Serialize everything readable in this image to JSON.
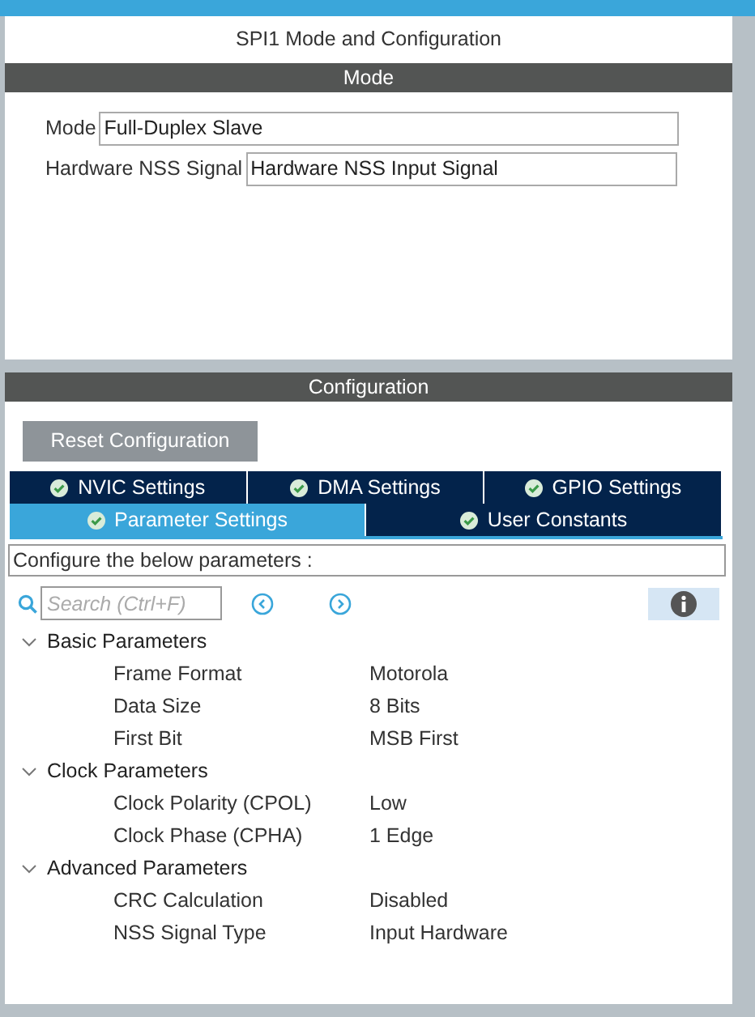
{
  "panel_title": "SPI1 Mode and Configuration",
  "mode_section": {
    "header": "Mode",
    "fields": [
      {
        "label": "Mode",
        "value": "Full-Duplex Slave"
      },
      {
        "label": "Hardware NSS Signal",
        "value": "Hardware NSS Input Signal"
      }
    ]
  },
  "configuration": {
    "header": "Configuration",
    "reset_button": "Reset Configuration",
    "tab_rows": [
      [
        {
          "label": "NVIC Settings",
          "selected": false
        },
        {
          "label": "DMA Settings",
          "selected": false
        },
        {
          "label": "GPIO Settings",
          "selected": false
        }
      ],
      [
        {
          "label": "Parameter Settings",
          "selected": true
        },
        {
          "label": "User Constants",
          "selected": false
        }
      ]
    ],
    "description": "Configure the below parameters :",
    "search": {
      "placeholder": "Search (Ctrl+F)"
    },
    "groups": [
      {
        "label": "Basic Parameters",
        "expanded": true,
        "children": [
          {
            "name": "Frame Format",
            "value": "Motorola"
          },
          {
            "name": "Data Size",
            "value": "8 Bits"
          },
          {
            "name": "First Bit",
            "value": "MSB First"
          }
        ]
      },
      {
        "label": "Clock Parameters",
        "expanded": true,
        "children": [
          {
            "name": "Clock Polarity (CPOL)",
            "value": "Low"
          },
          {
            "name": "Clock Phase (CPHA)",
            "value": "1 Edge"
          }
        ]
      },
      {
        "label": "Advanced Parameters",
        "expanded": true,
        "children": [
          {
            "name": "CRC Calculation",
            "value": "Disabled"
          },
          {
            "name": "NSS Signal Type",
            "value": "Input Hardware"
          }
        ]
      }
    ]
  }
}
